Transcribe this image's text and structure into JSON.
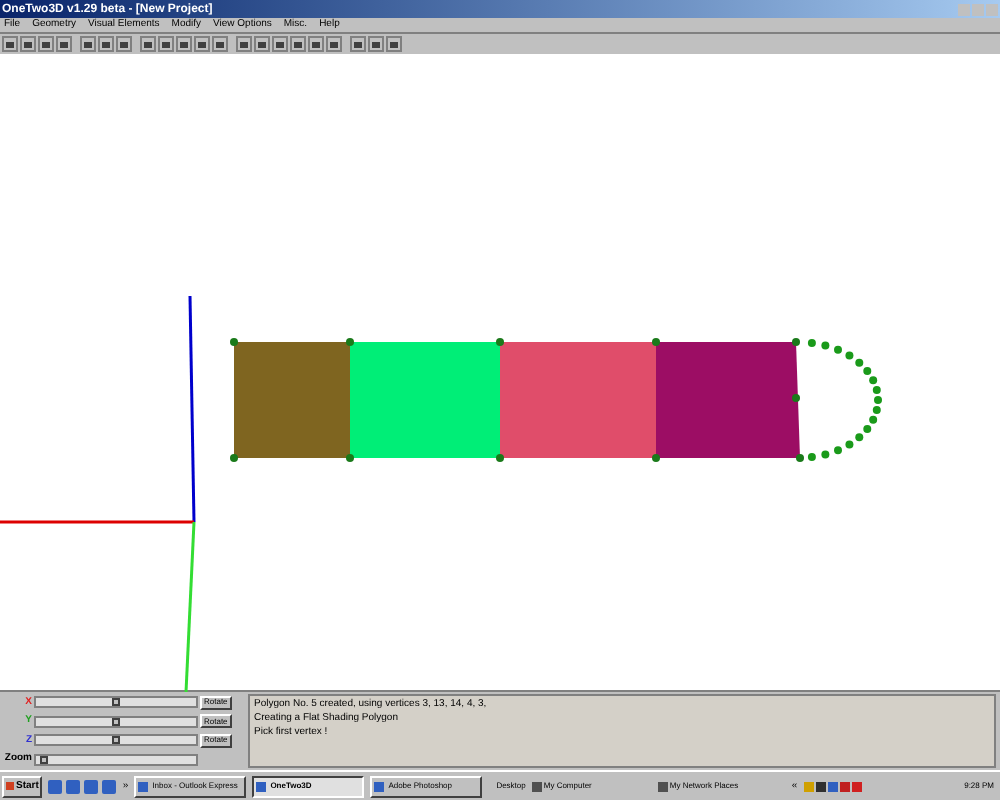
{
  "window": {
    "title": "OneTwo3D v1.29 beta - [New Project]"
  },
  "menu": [
    "File",
    "Geometry",
    "Visual Elements",
    "Modify",
    "View Options",
    "Misc.",
    "Help"
  ],
  "axes_controls": [
    {
      "label": "X",
      "color": "#e02020",
      "level": 0.5,
      "button": "Rotate"
    },
    {
      "label": "Y",
      "color": "#20a020",
      "level": 0.5,
      "button": "Rotate"
    },
    {
      "label": "Z",
      "color": "#3030d0",
      "level": 0.5,
      "button": "Rotate"
    },
    {
      "label": "Zoom",
      "color": "#000000",
      "level": 0.02
    }
  ],
  "log": [
    "Polygon No. 5 created, using vertices 3, 13, 14, 4, 3,",
    "Creating a Flat Shading Polygon",
    "Pick first vertex !"
  ],
  "taskbar": {
    "start": "Start",
    "overflow": "»",
    "tasks": [
      {
        "label": "Inbox - Outlook Express",
        "selected": false
      },
      {
        "label": "OneTwo3D",
        "selected": true
      },
      {
        "label": "Adobe Photoshop",
        "selected": false
      }
    ],
    "desktop": "Desktop",
    "shortcuts": [
      "My Computer",
      "My Network Places"
    ],
    "tray_overflow": "«",
    "clock": "9:28 PM"
  }
}
